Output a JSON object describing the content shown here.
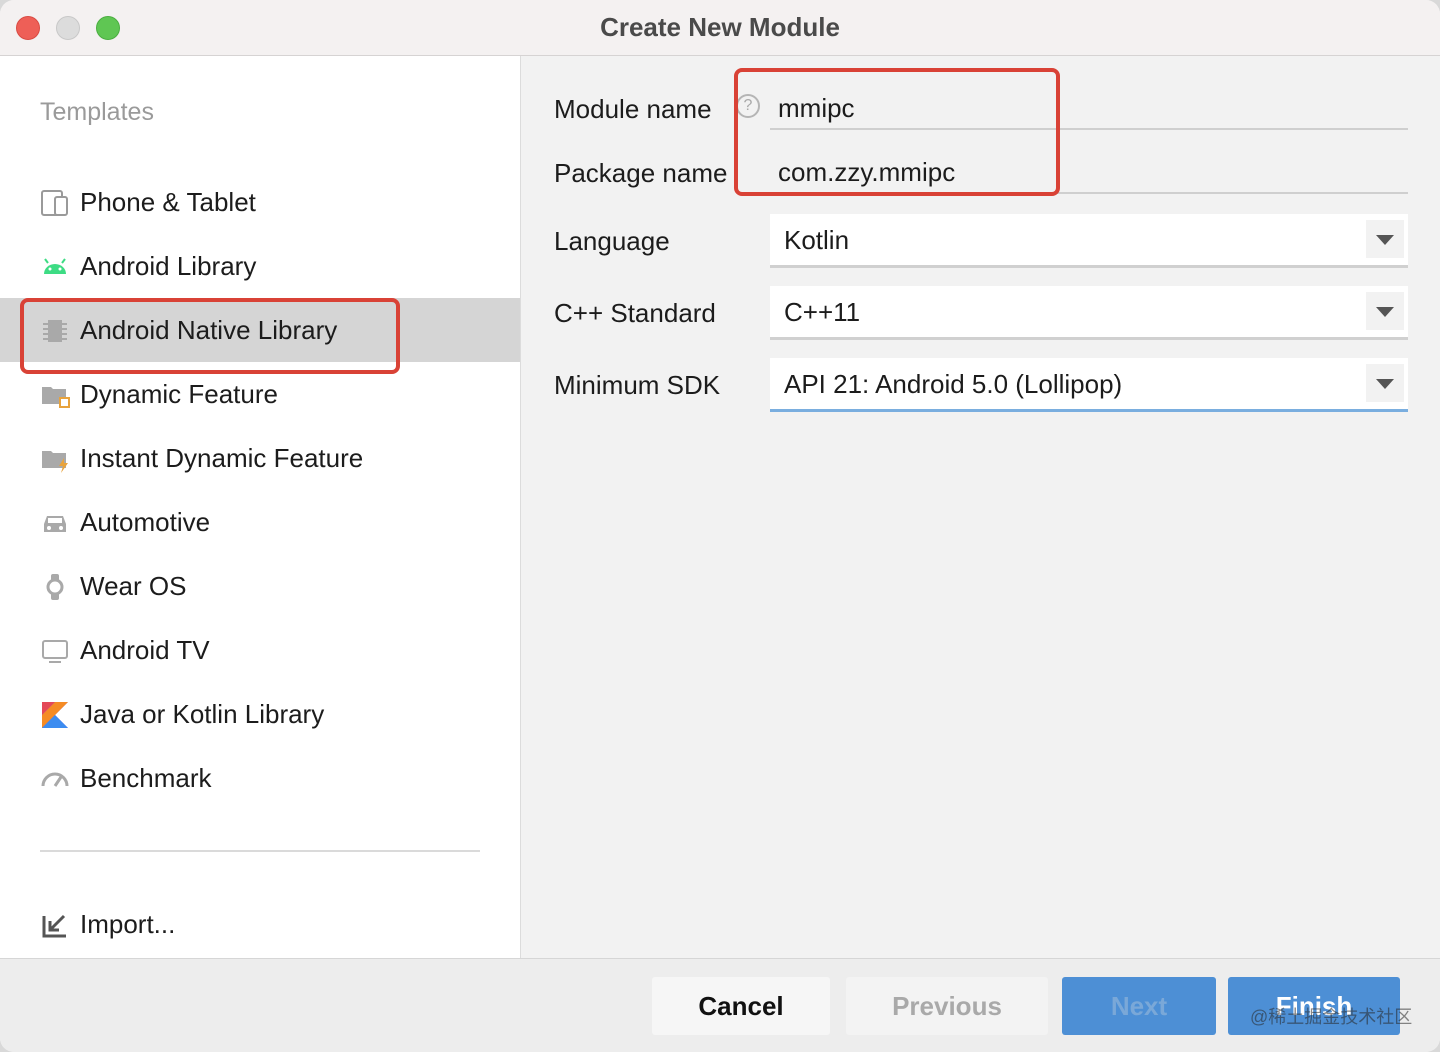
{
  "window": {
    "title": "Create New Module"
  },
  "sidebar": {
    "heading": "Templates",
    "items": [
      {
        "label": "Phone & Tablet",
        "icon": "phone-tablet-icon"
      },
      {
        "label": "Android Library",
        "icon": "android-icon"
      },
      {
        "label": "Android Native Library",
        "icon": "native-library-icon",
        "selected": true
      },
      {
        "label": "Dynamic Feature",
        "icon": "dynamic-feature-icon"
      },
      {
        "label": "Instant Dynamic Feature",
        "icon": "instant-dynamic-feature-icon"
      },
      {
        "label": "Automotive",
        "icon": "car-icon"
      },
      {
        "label": "Wear OS",
        "icon": "watch-icon"
      },
      {
        "label": "Android TV",
        "icon": "tv-icon"
      },
      {
        "label": "Java or Kotlin Library",
        "icon": "kotlin-icon"
      },
      {
        "label": "Benchmark",
        "icon": "gauge-icon"
      }
    ],
    "import_label": "Import..."
  },
  "form": {
    "module_name": {
      "label": "Module name",
      "value": "mmipc",
      "help": "?"
    },
    "package_name": {
      "label": "Package name",
      "value": "com.zzy.mmipc"
    },
    "language": {
      "label": "Language",
      "value": "Kotlin"
    },
    "cpp_standard": {
      "label": "C++ Standard",
      "value": "C++11"
    },
    "minimum_sdk": {
      "label": "Minimum SDK",
      "value": "API 21: Android 5.0 (Lollipop)"
    }
  },
  "footer": {
    "cancel": "Cancel",
    "previous": "Previous",
    "next": "Next",
    "finish": "Finish",
    "watermark": "@稀土掘金技术社区"
  },
  "colors": {
    "accent": "#4d8fd5",
    "highlight": "#d94236",
    "selected_bg": "#d5d5d5",
    "android_green": "#3ddc84"
  }
}
